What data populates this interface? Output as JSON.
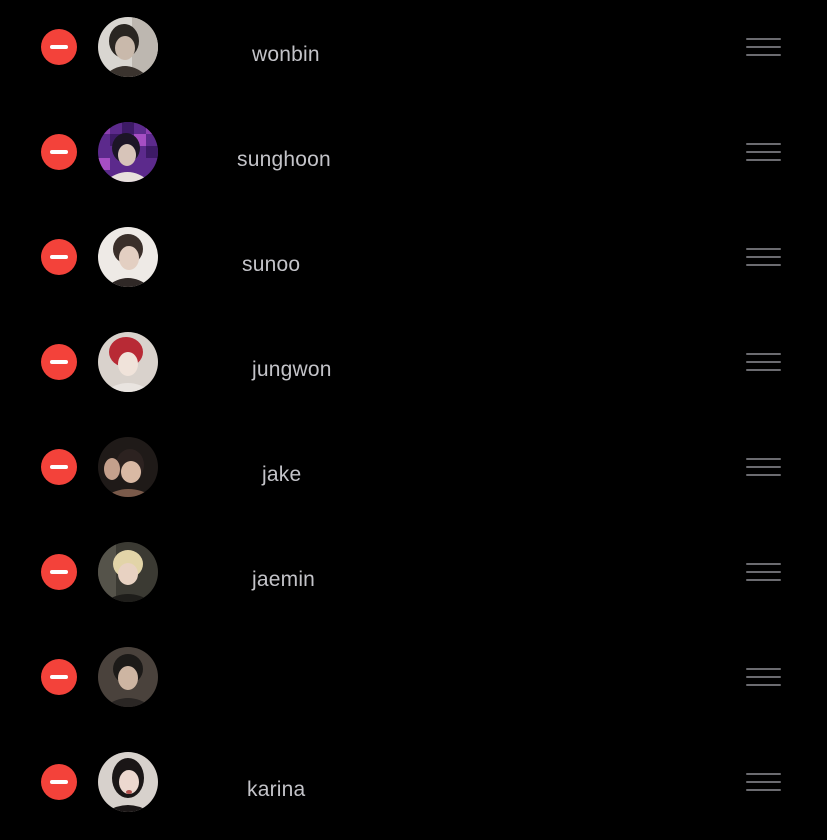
{
  "list": {
    "items": [
      {
        "name": "wonbin",
        "avatar_icon": "profile-photo-wonbin",
        "avatar_colors": [
          "#d9d6d1",
          "#2a2622",
          "#8f8479"
        ]
      },
      {
        "name": "sunghoon",
        "avatar_icon": "profile-photo-sunghoon",
        "avatar_colors": [
          "#5c2a8c",
          "#1c1526",
          "#e8e0dc"
        ]
      },
      {
        "name": "sunoo",
        "avatar_icon": "profile-photo-sunoo",
        "avatar_colors": [
          "#eeeae6",
          "#3a2f2a",
          "#d8c3b6"
        ]
      },
      {
        "name": "jungwon",
        "avatar_icon": "profile-photo-jungwon",
        "avatar_colors": [
          "#b82a35",
          "#6a1d23",
          "#f0e3da"
        ]
      },
      {
        "name": "jake",
        "avatar_icon": "profile-photo-jake",
        "avatar_colors": [
          "#1f1a18",
          "#7a5a4a",
          "#d9b9a4"
        ]
      },
      {
        "name": "jaemin",
        "avatar_icon": "profile-photo-jaemin",
        "avatar_colors": [
          "#e2d4a8",
          "#3b3a33",
          "#e8d2c2"
        ]
      },
      {
        "name": "",
        "avatar_icon": "profile-photo-unnamed",
        "avatar_colors": [
          "#4a423c",
          "#1c1a18",
          "#cdb5a2"
        ]
      },
      {
        "name": "karina",
        "avatar_icon": "profile-photo-karina",
        "avatar_colors": [
          "#d7d1cc",
          "#1a1616",
          "#ecd8cf"
        ]
      }
    ]
  },
  "colors": {
    "background": "#000000",
    "remove_button": "#f3423a",
    "name_text": "#c3c3c8",
    "drag_handle": "#6b6b70"
  },
  "icons": {
    "remove": "minus-circle-icon",
    "reorder": "drag-handle-icon"
  }
}
